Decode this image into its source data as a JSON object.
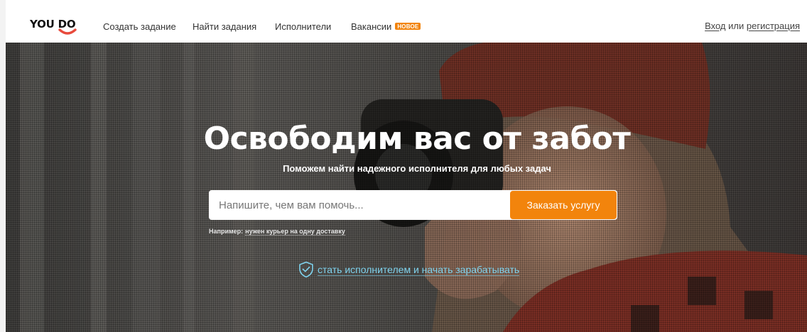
{
  "header": {
    "logo_text": "YOU DO",
    "nav": [
      {
        "label": "Создать задание"
      },
      {
        "label": "Найти задания"
      },
      {
        "label": "Исполнители"
      },
      {
        "label": "Вакансии",
        "badge": "НОВОЕ"
      }
    ],
    "auth": {
      "login": "Вход",
      "or": "или",
      "register": "регистрация"
    }
  },
  "hero": {
    "title": "Освободим вас от забот",
    "subtitle": "Поможем найти надежного исполнителя для любых задач",
    "search": {
      "placeholder": "Напишите, чем вам помочь...",
      "value": ""
    },
    "order_button": "Заказать услугу",
    "example_prefix": "Например:",
    "example_link": "нужен курьер на одну доставку",
    "become_link": "стать исполнителем и начать зарабатывать"
  },
  "colors": {
    "accent": "#f2840c",
    "link": "#7fd3ee",
    "logo_smile": "#e84a3c"
  },
  "icons": {
    "become": "shield-check-icon",
    "logo": "smile-icon"
  }
}
